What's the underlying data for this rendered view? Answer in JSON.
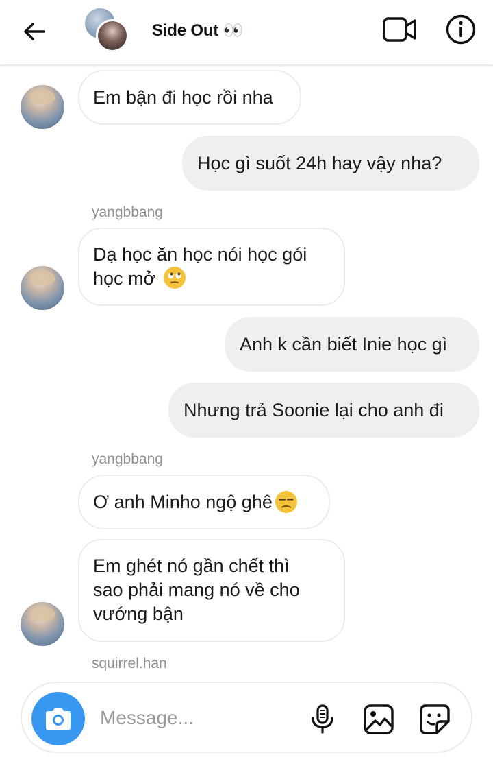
{
  "header": {
    "title": "Side Out 👀"
  },
  "messages": [
    {
      "id": "m1",
      "direction": "received",
      "sender": "",
      "text": "Em bận đi học rồi nha"
    },
    {
      "id": "m2",
      "direction": "sent",
      "text": "Học gì suốt 24h hay vậy nha?"
    },
    {
      "id": "m3",
      "direction": "received",
      "sender": "yangbbang",
      "text": "Dạ học ăn học nói học gói học mở 🙄"
    },
    {
      "id": "m4",
      "direction": "sent",
      "text": "Anh k cần biết Inie học gì"
    },
    {
      "id": "m5",
      "direction": "sent",
      "text": "Nhưng trả Soonie lại cho anh đi"
    },
    {
      "id": "m6",
      "direction": "received",
      "sender": "yangbbang",
      "text": "Ơ anh Minho ngộ ghê 😒"
    },
    {
      "id": "m7",
      "direction": "received",
      "sender": "",
      "text": "Em ghét nó gần chết thì sao phải mang nó về cho vướng bận"
    }
  ],
  "m3_line1": "Dạ học ăn học nói học gói",
  "m3_line2": "học mở",
  "m6_text": "Ơ anh Minho ngộ ghê",
  "m7_line1": "Em ghét nó gần chết thì",
  "m7_line2": "sao phải mang nó về cho",
  "m7_line3": "vướng bận",
  "senders": {
    "s1": "yangbbang",
    "s2": "yangbbang",
    "s3": "squirrel.han"
  },
  "composer": {
    "placeholder": "Message..."
  },
  "icons": {
    "back": "arrow-left-icon",
    "video": "video-camera-icon",
    "info": "info-icon",
    "camera": "camera-icon",
    "mic": "microphone-icon",
    "gallery": "image-icon",
    "sticker": "sticker-icon"
  },
  "colors": {
    "accent": "#3897f0",
    "sent_bubble": "#efefef",
    "received_border": "#ececec",
    "secondary_text": "#8e8e8e"
  }
}
